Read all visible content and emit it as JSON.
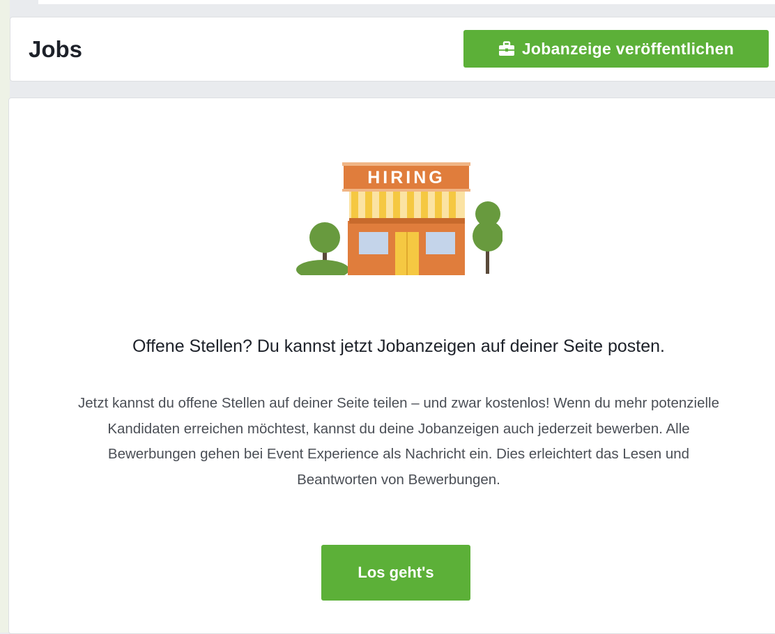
{
  "header": {
    "title": "Jobs",
    "post_button_label": "Jobanzeige veröffentlichen",
    "post_button_icon": "briefcase-icon"
  },
  "illustration": {
    "sign_text": "HIRING",
    "icon": "hiring-storefront-illustration"
  },
  "main": {
    "headline": "Offene Stellen? Du kannst jetzt Jobanzeigen auf deiner Seite posten.",
    "description": "Jetzt kannst du offene Stellen auf deiner Seite teilen – und zwar kostenlos! Wenn du mehr potenzielle Kandidaten erreichen möchtest, kannst du deine Jobanzeigen auch jederzeit bewerben. Alle Bewerbungen gehen bei Event Experience als Nachricht ein. Dies erleichtert das Lesen und Beantworten von Bewerbungen.",
    "cta_label": "Los geht's"
  },
  "colors": {
    "accent_green": "#5cb038",
    "page_background": "#e9ebee",
    "card_background": "#ffffff",
    "sign_orange": "#e07d3c",
    "awning_yellow": "#f5c842"
  }
}
